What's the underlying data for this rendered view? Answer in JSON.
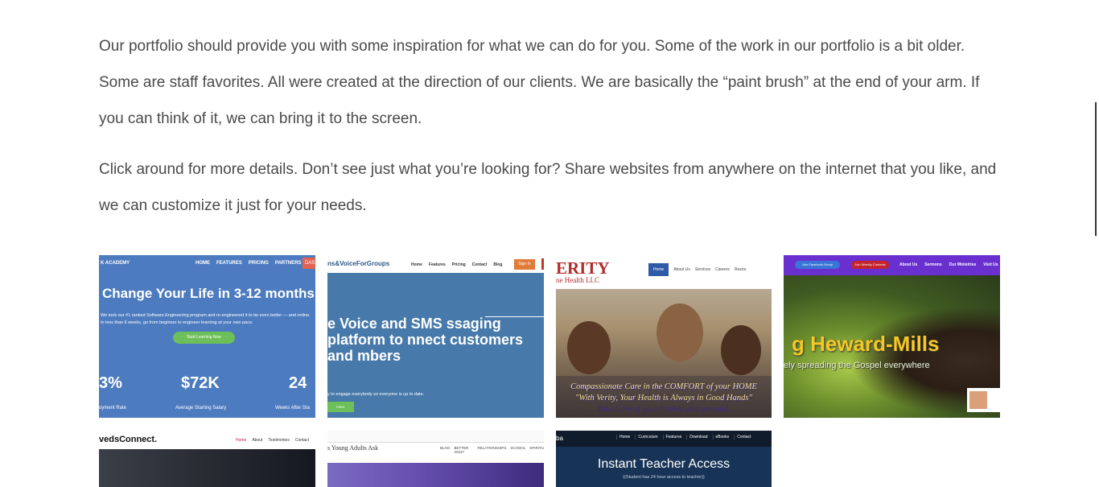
{
  "intro": {
    "paragraph1": "Our portfolio should provide you with some inspiration for what we can do for you. Some of the work in our portfolio is a bit older. Some are staff favorites. All were created at the direction of our clients. We are basically the “paint brush” at the end of your arm. If you can think of it, we can bring it to the screen.",
    "paragraph2": "Click around for more details. Don’t see just what you’re looking for? Share websites from anywhere on the internet that you like, and we can customize it just for your needs."
  },
  "portfolio": {
    "academy": {
      "brand": "K ACADEMY",
      "nav": [
        "HOME",
        "FEATURES",
        "PRICING",
        "PARTNERS"
      ],
      "dash": "DAS",
      "headline": "Change Your Life in 3-12 months",
      "sub": "We took our #1 ranked Software Engineering program and re-engineered it to be even better — and online. In less than 6 weeks, go from beginner to engineer learning at your own pace.",
      "cta": "Start Learning Now",
      "stats": [
        {
          "value": "3%",
          "label": "oyment Rate"
        },
        {
          "value": "$72K",
          "label": "Average Starting Salary"
        },
        {
          "value": "24",
          "label": "Weeks After Sta"
        }
      ]
    },
    "voice": {
      "brand": "ns&VoiceForGroups",
      "nav": [
        "Home",
        "Features",
        "Pricing",
        "Contact",
        "Blog"
      ],
      "signin": "Sign In",
      "headline": "e Voice and SMS ssaging platform to nnect customers and mbers",
      "sub": "y to engage everybody so everyone is up to date.",
      "cta": "FREE"
    },
    "verity": {
      "logo": "ERITY",
      "logo_sub": "ne Health LLC",
      "nav": [
        "Home",
        "About Us",
        "Services",
        "Careers",
        "Resou"
      ],
      "caption1": "Compassionate Care in the COMFORT of your HOME",
      "caption2": "\"With Verity, Your Health is Always in Good Hands\"",
      "caption3": "Take Care of your Family and get paid."
    },
    "ministry": {
      "pill1": "Join Facebook Group",
      "pill2": "Join Weekly Contests",
      "nav": [
        "About Us",
        "Sermons",
        "Our Ministries",
        "Visit Us"
      ],
      "name": "g Heward-Mills",
      "sub": "ely spreading the Gospel everywhere"
    },
    "connect": {
      "brand": "vedsConnect.",
      "nav": [
        "Home",
        "About",
        "Testimonies",
        "Contact"
      ]
    },
    "youngadults": {
      "brand": "s Young Adults Ask",
      "nav": [
        "BLOG",
        "BETTER 2023?",
        "RELATIONSHIPS",
        "SCHOOL",
        "SPIRITU"
      ]
    },
    "teacher": {
      "brand": "ba",
      "nav": [
        "Home",
        "Curriculum",
        "Features",
        "Download",
        "eBooks",
        "Contact"
      ],
      "headline": "Instant Teacher Access",
      "sub": "((Student has 24 hour access to teacher))"
    }
  }
}
